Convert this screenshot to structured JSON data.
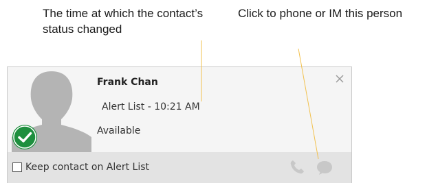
{
  "callouts": {
    "status_time": "The time at which the contact’s status changed",
    "contact_action": "Click to phone or IM this person"
  },
  "contact_card": {
    "name": "Frank Chan",
    "alert_line": "Alert List - 10:21 AM",
    "status": "Available",
    "presence": "available",
    "keep_on_list_label": "Keep contact on Alert List",
    "keep_on_list_checked": false,
    "icons": [
      "close-icon",
      "phone-icon",
      "chat-bubble-icon",
      "checkmark-icon",
      "person-silhouette-icon"
    ]
  },
  "colors": {
    "presence_available": "#1e8f3e",
    "leader_line": "#f2c14e",
    "action_icon": "#c8c8c8",
    "close_icon": "#9a9a9a"
  }
}
